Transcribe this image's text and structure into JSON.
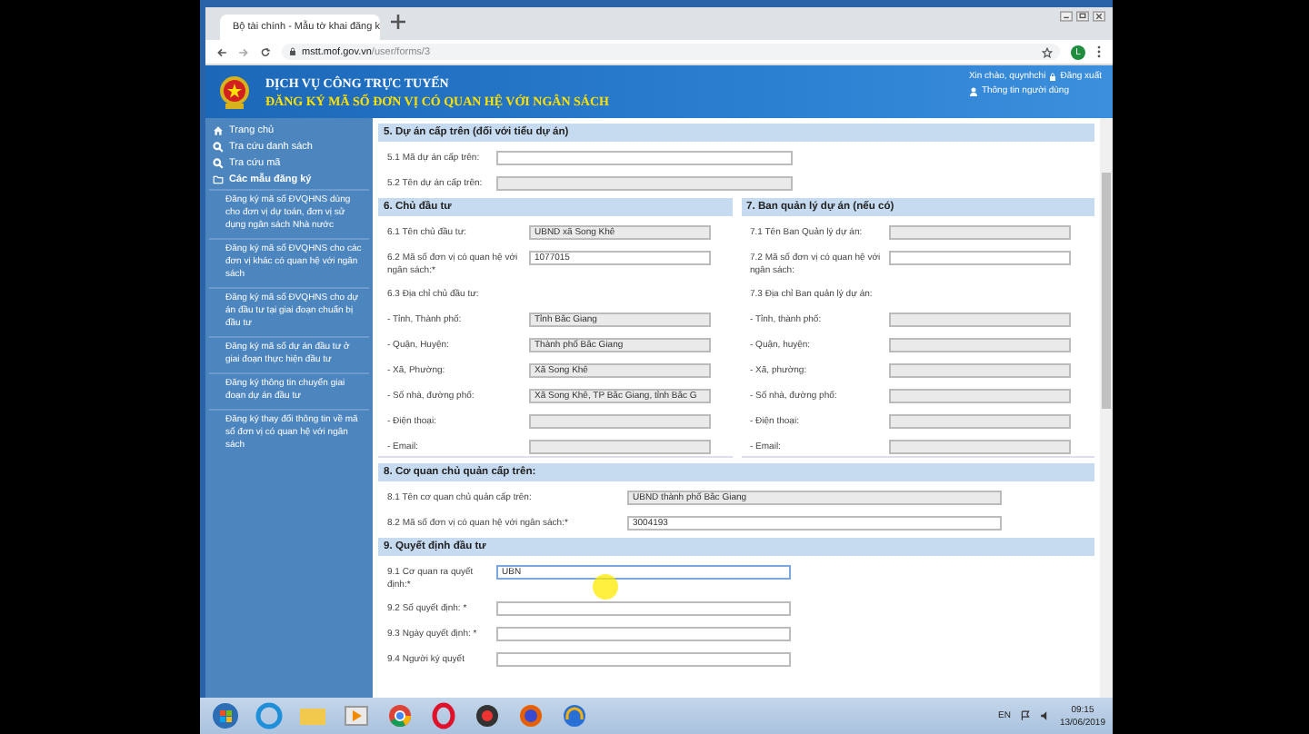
{
  "browser": {
    "tab_title": "Bộ tài chính - Mẫu tờ khai đăng k",
    "url_host": "mstt.mof.gov.vn",
    "url_path": "/user/forms/3",
    "profile": "L"
  },
  "header": {
    "title": "DỊCH VỤ CÔNG TRỰC TUYẾN",
    "subtitle": "ĐĂNG KÝ MÃ SỐ ĐƠN VỊ CÓ QUAN HỆ VỚI NGÂN SÁCH",
    "greeting": "Xin chào, quynhchi",
    "logout": "Đăng xuất",
    "user_info": "Thông tin người dùng"
  },
  "sidebar": {
    "items": [
      {
        "label": "Trang chủ",
        "kind": "home"
      },
      {
        "label": "Tra cứu danh sách",
        "kind": "search"
      },
      {
        "label": "Tra cứu mã",
        "kind": "search"
      },
      {
        "label": "Các mẫu đăng ký",
        "kind": "folder"
      }
    ],
    "forms": [
      "Đăng ký mã số ĐVQHNS dùng cho đơn vị dự toán, đơn vị sử dụng ngân sách Nhà nước",
      "Đăng ký mã số ĐVQHNS cho các đơn vị khác có quan hệ với ngân sách",
      "Đăng ký mã số ĐVQHNS cho dự án đầu tư tại giai đoạn chuẩn bị đầu tư",
      "Đăng ký mã số dự án đầu tư ở giai đoạn thực hiện đầu tư",
      "Đăng ký thông tin chuyển giai đoạn dự án đầu tư",
      "Đăng ký thay đổi thông tin về mã số đơn vị có quan hệ với ngân sách"
    ]
  },
  "section_5": {
    "title": "5. Dự án cấp trên (đối với tiểu dự án)",
    "fields": [
      {
        "label": "5.1 Mã dự án cấp trên:",
        "kind": "input"
      },
      {
        "label": "5.2 Tên dự án cấp trên:",
        "kind": "readonly"
      }
    ]
  },
  "section_6": {
    "title": "6. Chủ đầu tư",
    "fields": [
      {
        "label": "6.1 Tên chủ đầu tư:",
        "kind": "readonly",
        "value": "UBND xã Song Khê"
      },
      {
        "label": "6.2 Mã số đơn vị có quan hệ với ngân sách:*",
        "kind": "input",
        "value": "1077015"
      },
      {
        "label": "6.3 Địa chỉ chủ đầu tư:",
        "kind": "heading"
      },
      {
        "label": "- Tỉnh, Thành phố:",
        "kind": "readonly",
        "value": "Tỉnh Bắc Giang"
      },
      {
        "label": "- Quận, Huyện:",
        "kind": "readonly",
        "value": "Thành phố Bắc Giang"
      },
      {
        "label": "- Xã, Phường:",
        "kind": "readonly",
        "value": "Xã Song Khê"
      },
      {
        "label": "- Số nhà, đường phố:",
        "kind": "readonly",
        "value": "Xã Song Khê, TP Bắc Giang, tỉnh Bắc G"
      },
      {
        "label": "- Điện thoại:",
        "kind": "readonly"
      },
      {
        "label": "- Email:",
        "kind": "readonly"
      }
    ]
  },
  "section_7": {
    "title": "7. Ban quản lý dự án (nếu có)",
    "fields": [
      {
        "label": "7.1 Tên Ban Quản lý dự án:",
        "kind": "readonly"
      },
      {
        "label": "7.2 Mã số đơn vị có quan hệ với ngân sách:",
        "kind": "input"
      },
      {
        "label": "7.3 Địa chỉ Ban quản lý dự án:",
        "kind": "heading"
      },
      {
        "label": "- Tỉnh, thành phố:",
        "kind": "readonly"
      },
      {
        "label": "- Quận, huyện:",
        "kind": "readonly"
      },
      {
        "label": "- Xã, phường:",
        "kind": "readonly"
      },
      {
        "label": "- Số nhà, đường phố:",
        "kind": "readonly"
      },
      {
        "label": "- Điện thoại:",
        "kind": "readonly"
      },
      {
        "label": "- Email:",
        "kind": "readonly"
      }
    ]
  },
  "section_8": {
    "title": "8. Cơ quan chủ quản cấp trên:",
    "fields": [
      {
        "label": "8.1 Tên cơ quan chủ quản cấp trên:",
        "kind": "readonly",
        "value": "UBND thành phố Bắc Giang"
      },
      {
        "label": "8.2 Mã số đơn vị có quan hệ với ngân sách:*",
        "kind": "input",
        "value": "3004193"
      }
    ]
  },
  "section_9": {
    "title": "9. Quyết định đầu tư",
    "fields": [
      {
        "label": "9.1 Cơ quan ra quyết định:*",
        "kind": "input",
        "value": "UBN",
        "focused": true
      },
      {
        "label": "9.2 Số quyết định: *",
        "kind": "input",
        "focused": false
      },
      {
        "label": "9.3 Ngày quyết định: *",
        "kind": "input",
        "focused": false
      },
      {
        "label": "9.4 Người ký quyết",
        "kind": "input",
        "focused": false
      }
    ]
  },
  "taskbar": {
    "language": "EN",
    "time": "09:15",
    "date": "13/06/2019"
  }
}
